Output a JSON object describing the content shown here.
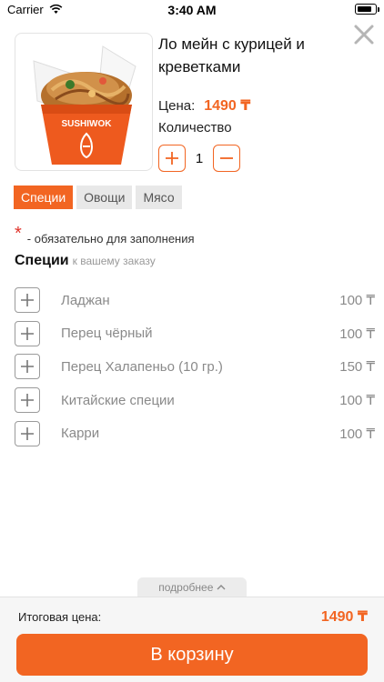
{
  "status": {
    "carrier": "Carrier",
    "time": "3:40 AM"
  },
  "product": {
    "title": "Ло мейн с курицей и креветками",
    "image_brand": "SUSHIWOK",
    "price_label": "Цена:",
    "price_value": "1490 ₸",
    "qty_label": "Количество",
    "qty_value": "1"
  },
  "tabs": [
    {
      "label": "Специи",
      "active": true
    },
    {
      "label": "Овощи",
      "active": false
    },
    {
      "label": "Мясо",
      "active": false
    }
  ],
  "required": {
    "star": "*",
    "text": "- обязательно для заполнения"
  },
  "section": {
    "title": "Специи",
    "subtitle": "к вашему заказу"
  },
  "options": [
    {
      "name": "Ладжан",
      "price": "100 ₸"
    },
    {
      "name": "Перец чёрный",
      "price": "100 ₸"
    },
    {
      "name": "Перец Халапеньо (10 гр.)",
      "price": "150 ₸"
    },
    {
      "name": "Китайские специи",
      "price": "100 ₸"
    },
    {
      "name": "Карри",
      "price": "100 ₸"
    }
  ],
  "more": {
    "label": "подробнее"
  },
  "footer": {
    "total_label": "Итоговая цена:",
    "total_value": "1490 ₸",
    "cart_button": "В корзину"
  },
  "colors": {
    "accent": "#f26522",
    "required": "#e0332b"
  },
  "icons": [
    "wifi-icon",
    "battery-icon",
    "close-icon",
    "plus-icon",
    "minus-icon",
    "chevron-up-icon"
  ]
}
